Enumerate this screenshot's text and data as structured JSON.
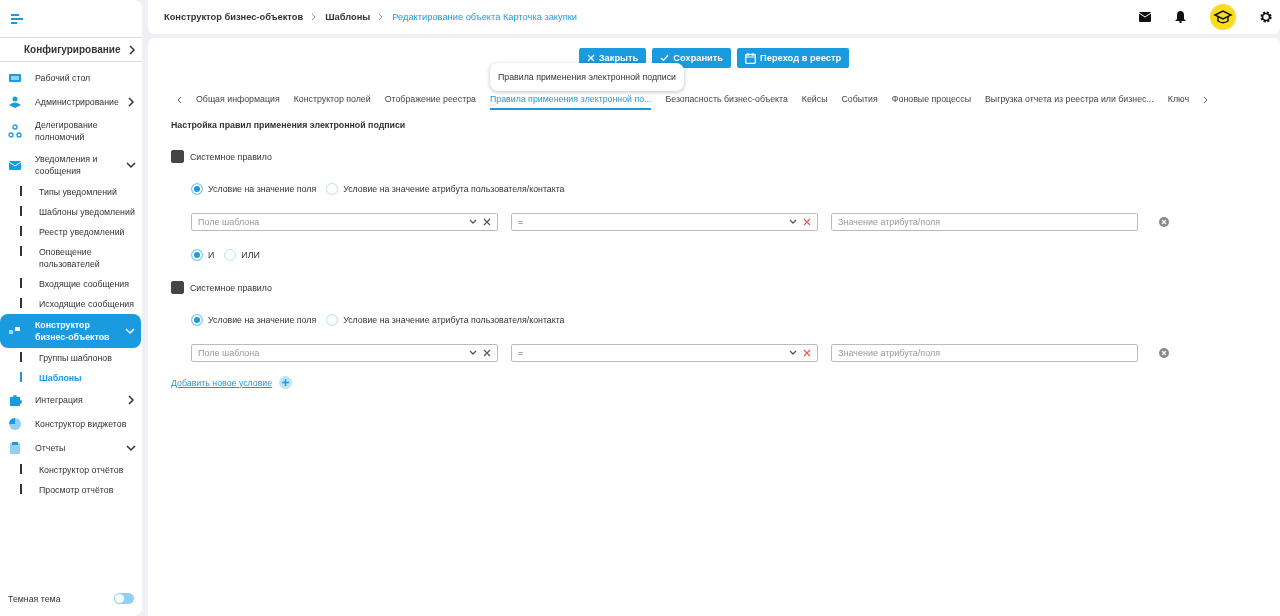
{
  "sidebar": {
    "section": "Конфигурирование",
    "items": [
      {
        "label": "Рабочий стол",
        "selected": false
      },
      {
        "label": "Администрирование",
        "selected": false,
        "expanded": false
      },
      {
        "label": "Делегирование полномочий",
        "selected": false
      },
      {
        "label": "Уведомления и сообщения",
        "selected": false,
        "expanded": true,
        "children": [
          {
            "label": "Типы уведомлений",
            "selected": false
          },
          {
            "label": "Шаблоны уведомлений",
            "selected": false
          },
          {
            "label": "Реестр уведомлений",
            "selected": false
          },
          {
            "label": "Оповещение пользователей",
            "selected": false
          },
          {
            "label": "Входящие сообщения",
            "selected": false
          },
          {
            "label": "Исходящие сообщения",
            "selected": false
          }
        ]
      },
      {
        "label": "Конструктор бизнес-объектов",
        "selected": true,
        "expanded": true,
        "children": [
          {
            "label": "Группы шаблонов",
            "selected": false
          },
          {
            "label": "Шаблоны",
            "selected": true
          }
        ]
      },
      {
        "label": "Интеграция",
        "selected": false,
        "expanded": false
      },
      {
        "label": "Конструктор виджетов",
        "selected": false
      },
      {
        "label": "Отчеты",
        "selected": false,
        "expanded": true,
        "children": [
          {
            "label": "Конструктор отчётов",
            "selected": false
          },
          {
            "label": "Просмотр отчётов",
            "selected": false
          }
        ]
      }
    ],
    "dark_theme": {
      "label": "Темная тема",
      "on": false
    }
  },
  "breadcrumbs": [
    {
      "label": "Конструктор бизнес-объектов",
      "current": false
    },
    {
      "label": "Шаблоны",
      "current": false
    },
    {
      "label": "Редактирование объекта Карточка закупки",
      "current": true
    }
  ],
  "toolbar": {
    "buttons": [
      {
        "kind": "close",
        "label": "Закрыть"
      },
      {
        "kind": "save",
        "label": "Сохранить"
      },
      {
        "kind": "registry",
        "label": "Переход в реестр"
      }
    ],
    "tooltip": "Правила применения электронной подписи"
  },
  "tabs": [
    {
      "label": "Общая информация",
      "selected": false
    },
    {
      "label": "Конструктор полей",
      "selected": false
    },
    {
      "label": "Отображение реестра",
      "selected": false
    },
    {
      "label": "Правила применения электронной по...",
      "selected": true
    },
    {
      "label": "Безопасность бизнес-объекта",
      "selected": false
    },
    {
      "label": "Кейсы",
      "selected": false
    },
    {
      "label": "События",
      "selected": false
    },
    {
      "label": "Фоновые процессы",
      "selected": false
    },
    {
      "label": "Выгрузка отчета из реестра или бизнес...",
      "selected": false
    },
    {
      "label": "Ключ",
      "selected": false
    }
  ],
  "section_title": "Настройка правил применения электронной подписи",
  "rules": [
    {
      "system_rule": {
        "label": "Системное правило",
        "checked": true
      },
      "condition_types": [
        {
          "label": "Условие на значение поля",
          "selected": true
        },
        {
          "label": "Условие на значение атрибута пользователя/контакта",
          "selected": false
        }
      ],
      "field": {
        "placeholder": "Поле шаблона"
      },
      "operator": {
        "value": "="
      },
      "value": {
        "placeholder": "Значение атрибута/поля"
      },
      "logic": [
        {
          "label": "И",
          "selected": true
        },
        {
          "label": "ИЛИ",
          "selected": false
        }
      ]
    },
    {
      "system_rule": {
        "label": "Системное правило",
        "checked": true
      },
      "condition_types": [
        {
          "label": "Условие на значение поля",
          "selected": true
        },
        {
          "label": "Условие на значение атрибута пользователя/контакта",
          "selected": false
        }
      ],
      "field": {
        "placeholder": "Поле шаблона"
      },
      "operator": {
        "value": "="
      },
      "value": {
        "placeholder": "Значение атрибута/поля"
      }
    }
  ],
  "add_condition": "Добавить новое условие"
}
